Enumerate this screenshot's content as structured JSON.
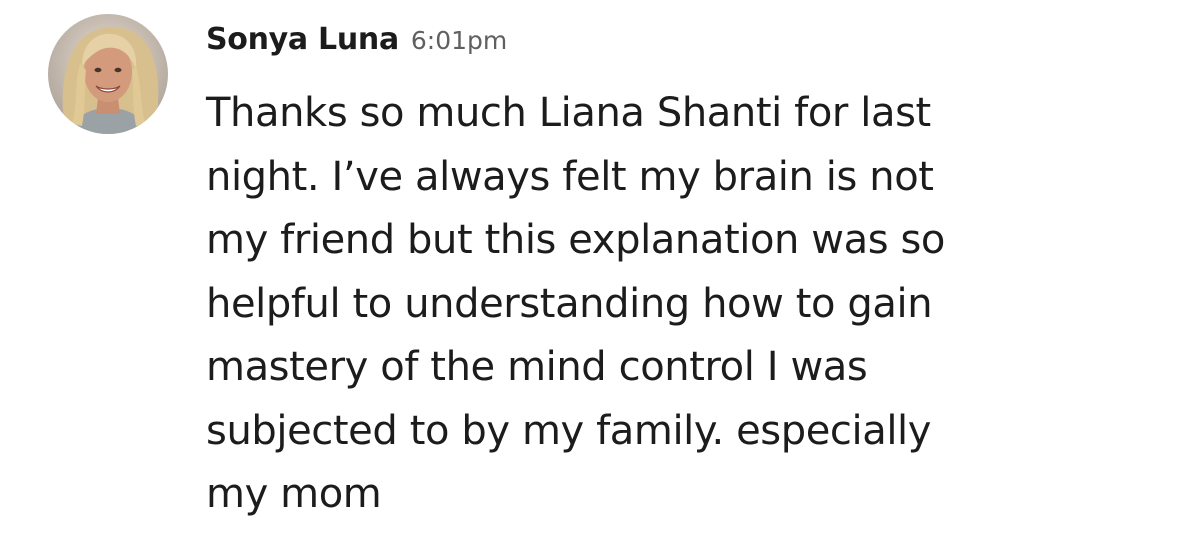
{
  "message": {
    "author": "Sonya Luna",
    "timestamp": "6:01pm",
    "avatar_icon": "user-avatar-photo",
    "lines": [
      "Thanks so much Liana Shanti for last",
      "night. I’ve always felt my brain is not",
      "my friend but this explanation was so",
      "helpful to understanding how to gain",
      "mastery of the mind control I was",
      "subjected to by my family. especially",
      "my mom"
    ]
  },
  "colors": {
    "background": "#ffffff",
    "text": "#1d1c1d",
    "timestamp": "#616061"
  }
}
